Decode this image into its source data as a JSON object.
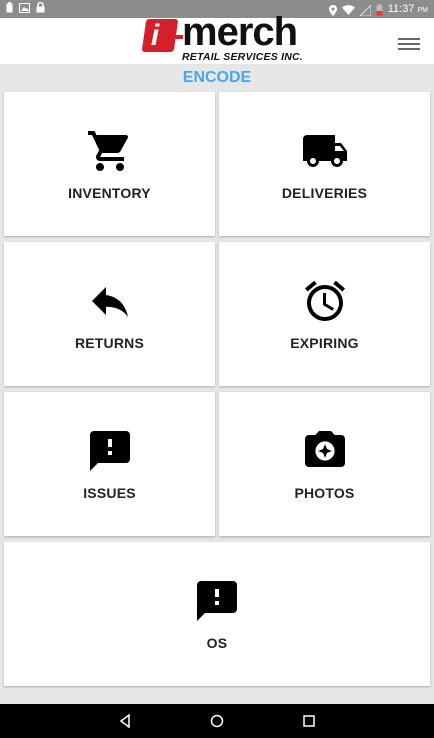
{
  "status_bar": {
    "time": "11:37",
    "ampm": "PM"
  },
  "header": {
    "brand": "merch",
    "brand_prefix": "i",
    "tagline": "RETAIL SERVICES INC."
  },
  "section": {
    "title": "ENCODE"
  },
  "tiles": [
    {
      "label": "INVENTORY",
      "icon": "shopping-cart-icon"
    },
    {
      "label": "DELIVERIES",
      "icon": "truck-icon"
    },
    {
      "label": "RETURNS",
      "icon": "reply-arrow-icon"
    },
    {
      "label": "EXPIRING",
      "icon": "alarm-clock-icon"
    },
    {
      "label": "ISSUES",
      "icon": "feedback-alert-icon"
    },
    {
      "label": "PHOTOS",
      "icon": "camera-icon"
    },
    {
      "label": "OS",
      "icon": "feedback-alert-icon"
    }
  ],
  "colors": {
    "accent": "#4aa6e8",
    "brand_red": "#d4202a",
    "status_bar": "#8c8c8c"
  }
}
